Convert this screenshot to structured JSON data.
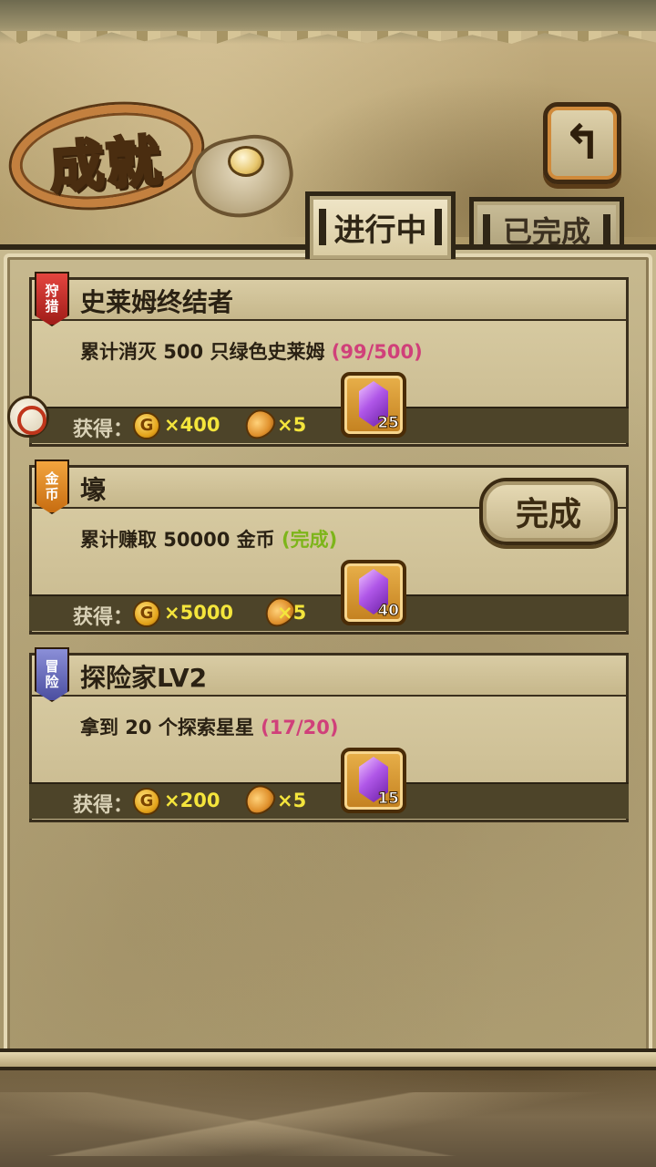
{
  "header": {
    "title": "成就",
    "back_icon": "↰"
  },
  "tabs": [
    {
      "label": "进行中",
      "active": true
    },
    {
      "label": "已完成",
      "active": false
    }
  ],
  "achievements": [
    {
      "badge": [
        "狩",
        "猎"
      ],
      "badge_color": "#c62a24",
      "name": "史莱姆终结者",
      "desc": "累计消灭 500 只绿色史莱姆 ",
      "progress": "(99/500)",
      "progress_color": "#d0407a",
      "reward_label": "获得：",
      "coin_icon": "G",
      "coins": "×400",
      "bread": "×5",
      "gems": "25"
    },
    {
      "badge": [
        "金",
        "币"
      ],
      "badge_color": "#e38a22",
      "name": "壕",
      "desc": "累计赚取 50000 金币 ",
      "progress": "(完成)",
      "progress_color": "#7db51a",
      "reward_label": "获得：",
      "coin_icon": "G",
      "coins": "×5000",
      "bread": "×5",
      "gems": "40",
      "complete_label": "完成"
    },
    {
      "badge": [
        "冒",
        "险"
      ],
      "badge_color": "#6a6ec4",
      "name": "探险家LV2",
      "desc": "拿到 20 个探索星星 ",
      "progress": "(17/20)",
      "progress_color": "#d0407a",
      "reward_label": "获得：",
      "coin_icon": "G",
      "coins": "×200",
      "bread": "×5",
      "gems": "15"
    }
  ]
}
